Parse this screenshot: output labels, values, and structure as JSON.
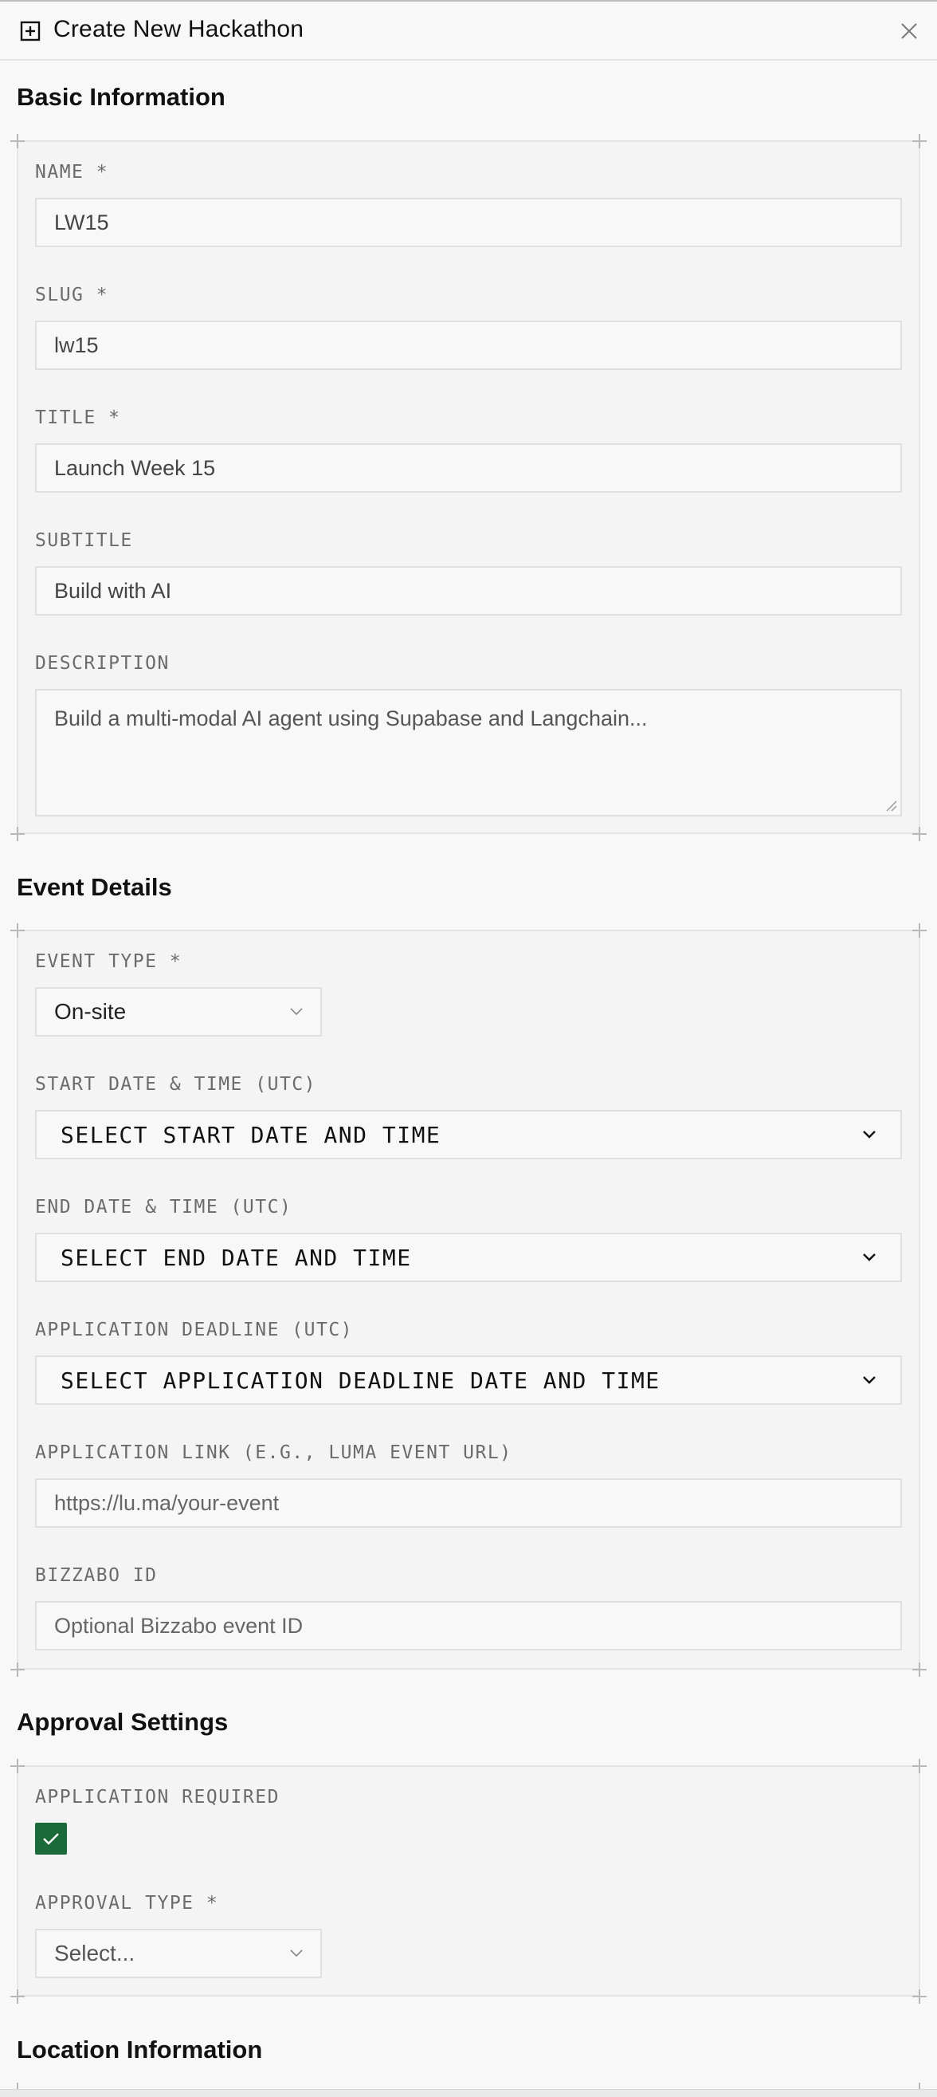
{
  "header": {
    "title": "Create New Hackathon"
  },
  "basic": {
    "title": "Basic Information",
    "name_label": "NAME *",
    "name_value": "LW15",
    "slug_label": "SLUG *",
    "slug_value": "lw15",
    "title_label": "TITLE *",
    "title_value": "Launch Week 15",
    "subtitle_label": "SUBTITLE",
    "subtitle_value": "Build with AI",
    "description_label": "DESCRIPTION",
    "description_placeholder": "Build a multi-modal AI agent using Supabase and Langchain..."
  },
  "event": {
    "title": "Event Details",
    "type_label": "EVENT TYPE *",
    "type_value": "On-site",
    "start_label": "START DATE & TIME (UTC)",
    "start_placeholder": "SELECT START DATE AND TIME",
    "end_label": "END DATE & TIME (UTC)",
    "end_placeholder": "SELECT END DATE AND TIME",
    "deadline_label": "APPLICATION DEADLINE (UTC)",
    "deadline_placeholder": "SELECT APPLICATION DEADLINE DATE AND TIME",
    "link_label": "APPLICATION LINK (E.G., LUMA EVENT URL)",
    "link_placeholder": "https://lu.ma/your-event",
    "bizzabo_label": "BIZZABO ID",
    "bizzabo_placeholder": "Optional Bizzabo event ID"
  },
  "approval": {
    "title": "Approval Settings",
    "required_label": "APPLICATION REQUIRED",
    "required_checked": true,
    "type_label": "APPROVAL TYPE *",
    "type_value": "Select..."
  },
  "location": {
    "title": "Location Information"
  },
  "colors": {
    "accent": "#1b6b3a",
    "border": "#e0e0e0",
    "background": "#f8f8f8"
  }
}
